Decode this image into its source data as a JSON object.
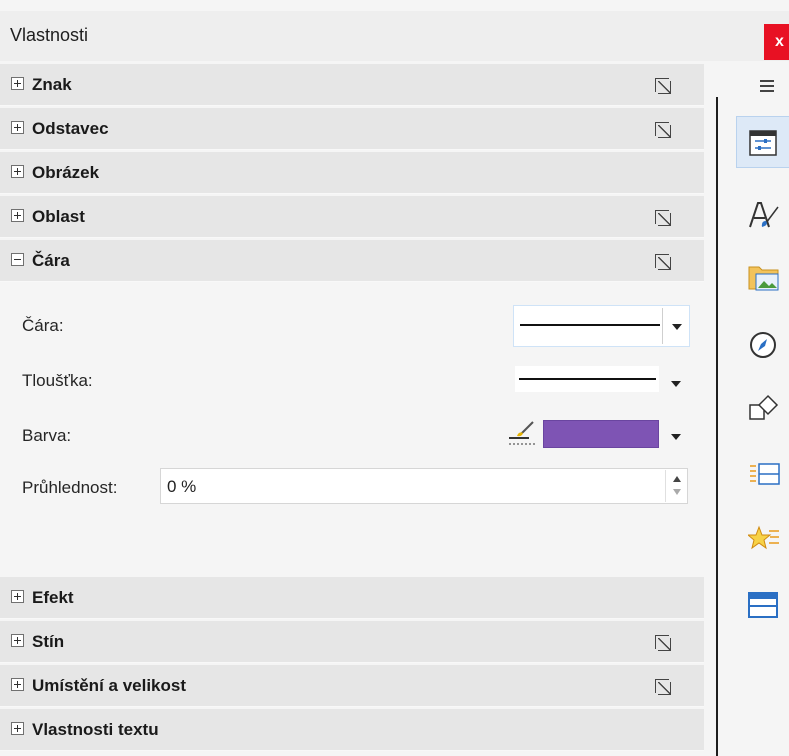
{
  "window": {
    "title": "Vlastnosti",
    "close_label": "x"
  },
  "sections_top": [
    {
      "label": "Znak",
      "expanded": false,
      "has_more": true
    },
    {
      "label": "Odstavec",
      "expanded": false,
      "has_more": true
    },
    {
      "label": "Obrázek",
      "expanded": false,
      "has_more": false
    },
    {
      "label": "Oblast",
      "expanded": false,
      "has_more": true
    },
    {
      "label": "Čára",
      "expanded": true,
      "has_more": true
    }
  ],
  "line_panel": {
    "line_label": "Čára:",
    "thickness_label": "Tloušťka:",
    "color_label": "Barva:",
    "color_value": "#7e54b4",
    "transparency_label": "Průhlednost:",
    "transparency_value": "0 %"
  },
  "sections_bottom": [
    {
      "label": "Efekt",
      "expanded": false,
      "has_more": false
    },
    {
      "label": "Stín",
      "expanded": false,
      "has_more": true
    },
    {
      "label": "Umístění a velikost",
      "expanded": false,
      "has_more": true
    },
    {
      "label": "Vlastnosti textu",
      "expanded": false,
      "has_more": false
    }
  ],
  "tabs": [
    {
      "icon": "properties-icon",
      "active": true
    },
    {
      "icon": "styles-icon",
      "active": false
    },
    {
      "icon": "gallery-icon",
      "active": false
    },
    {
      "icon": "navigator-icon",
      "active": false
    },
    {
      "icon": "shapes-icon",
      "active": false
    },
    {
      "icon": "slide-transition-icon",
      "active": false
    },
    {
      "icon": "animation-icon",
      "active": false
    },
    {
      "icon": "master-slides-icon",
      "active": false
    }
  ]
}
